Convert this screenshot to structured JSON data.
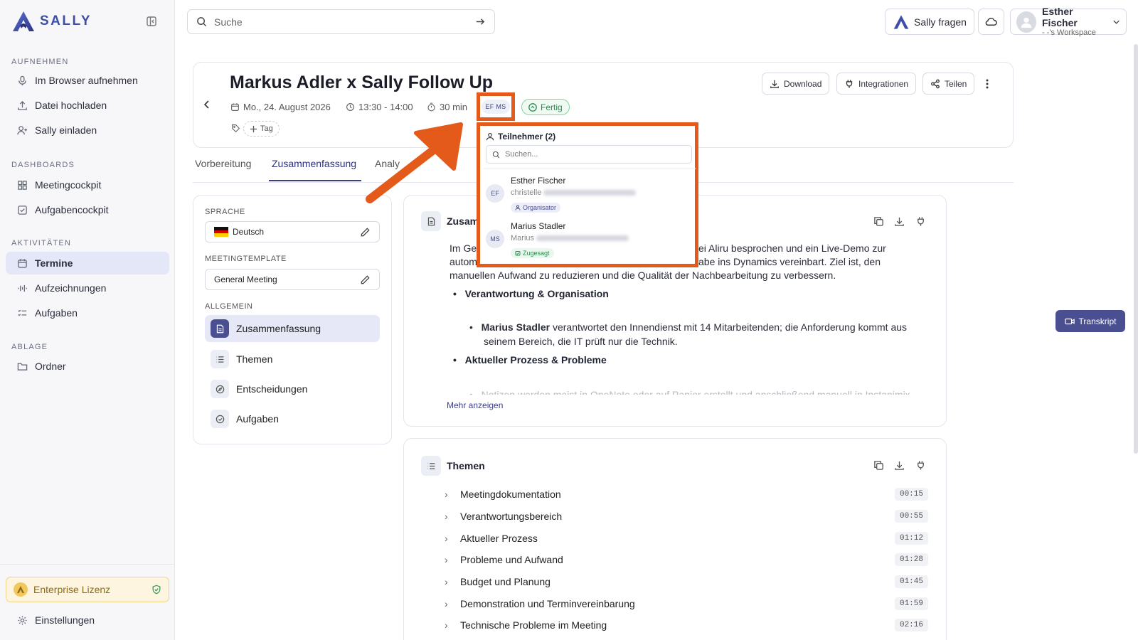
{
  "app": {
    "name": "SALLY"
  },
  "sidebar": {
    "sections": {
      "record": "AUFNEHMEN",
      "dashboards": "DASHBOARDS",
      "activities": "AKTIVITÄTEN",
      "storage": "ABLAGE"
    },
    "items": {
      "browser": "Im Browser aufnehmen",
      "upload": "Datei hochladen",
      "invite": "Sally einladen",
      "meetingcockpit": "Meetingcockpit",
      "taskcockpit": "Aufgabencockpit",
      "appointments": "Termine",
      "recordings": "Aufzeichnungen",
      "tasks": "Aufgaben",
      "folders": "Ordner"
    },
    "license": "Enterprise Lizenz",
    "settings": "Einstellungen"
  },
  "topbar": {
    "search_placeholder": "Suche",
    "ask": "Sally fragen",
    "user_name": "Esther Fischer",
    "workspace": "- -'s Workspace"
  },
  "meeting": {
    "title": "Markus Adler x Sally Follow Up",
    "date": "Mo., 24. August 2026",
    "time": "13:30 - 14:00",
    "duration": "30 min",
    "avatars": "EF MS",
    "status": "Fertig",
    "tag": "Tag",
    "actions": {
      "download": "Download",
      "integrations": "Integrationen",
      "share": "Teilen"
    }
  },
  "tabs": [
    "Vorbereitung",
    "Zusammenfassung",
    "Analy"
  ],
  "left_panel": {
    "language_label": "SPRACHE",
    "language": "Deutsch",
    "template_label": "MEETINGTEMPLATE",
    "template": "General Meeting",
    "general_label": "ALLGEMEIN",
    "items": [
      "Zusammenfassung",
      "Themen",
      "Entscheidungen",
      "Aufgaben"
    ]
  },
  "summary": {
    "title": "Zusam",
    "line1a": "Im Ges",
    "line1b": "ei Aliru besprochen und ein Live-Demo zur",
    "line2a": "autom",
    "line2b": "abe ins Dynamics vereinbart. Ziel ist, den",
    "line3": "manuellen Aufwand zu reduzieren und die Qualität der Nachbearbeitung zu verbessern.",
    "b1": "Verantwortung & Organisation",
    "b2_name": "Marius Stadler",
    "b2_text": "verantwortet den Innendienst mit 14 Mitarbeitenden; die Anforderung kommt aus",
    "b2_text2": "seinem Bereich, die IT prüft nur die Technik.",
    "b3": "Aktueller Prozess & Probleme",
    "b4_name": "Notizen",
    "b4_text": "werden meist in OneNote oder auf Papier erstellt und anschließend manuell in Instanimix",
    "more": "Mehr anzeigen"
  },
  "themes": {
    "title": "Themen",
    "rows": [
      {
        "label": "Meetingdokumentation",
        "time": "00:15"
      },
      {
        "label": "Verantwortungsbereich",
        "time": "00:55"
      },
      {
        "label": "Aktueller Prozess",
        "time": "01:12"
      },
      {
        "label": "Probleme und Aufwand",
        "time": "01:28"
      },
      {
        "label": "Budget und Planung",
        "time": "01:45"
      },
      {
        "label": "Demonstration und Terminvereinbarung",
        "time": "01:59"
      },
      {
        "label": "Technische Probleme im Meeting",
        "time": "02:16"
      }
    ]
  },
  "transcript": "Transkript",
  "participants": {
    "header": "Teilnehmer (2)",
    "search_placeholder": "Suchen...",
    "people": [
      {
        "initials": "EF",
        "name": "Esther Fischer",
        "sub": "christelle",
        "badge": "Organisator"
      },
      {
        "initials": "MS",
        "name": "Marius Stadler",
        "sub": "Marius",
        "badge": "Zugesagt"
      }
    ]
  },
  "colors": {
    "accent": "#4a4f92",
    "highlight": "#e35a1b",
    "success": "#3a9a5b"
  }
}
